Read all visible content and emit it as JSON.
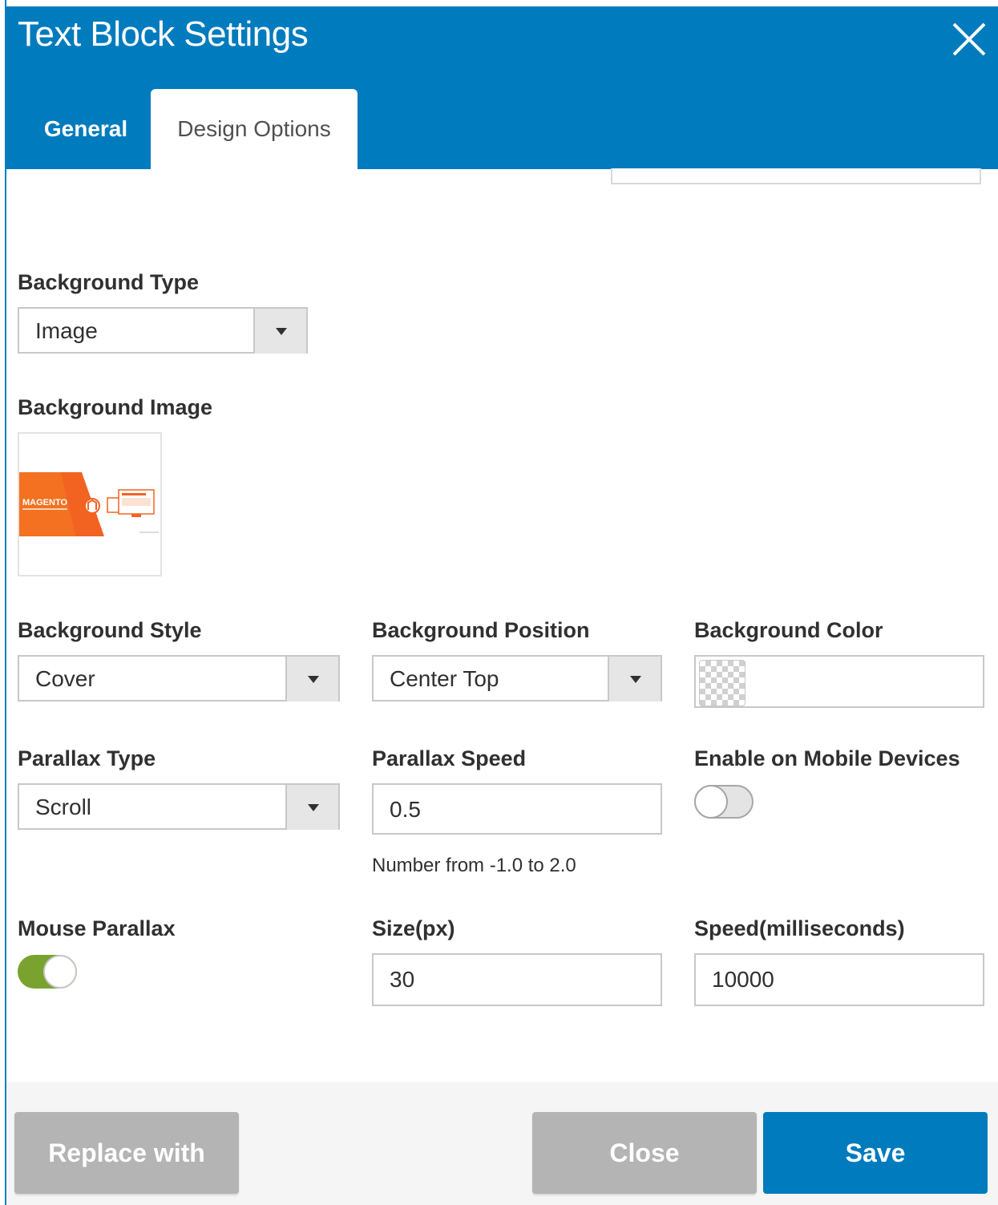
{
  "modal": {
    "title": "Text Block Settings",
    "tabs": [
      {
        "label": "General",
        "active": false
      },
      {
        "label": "Design Options",
        "active": true
      }
    ]
  },
  "form": {
    "background_type": {
      "label": "Background Type",
      "value": "Image"
    },
    "background_image": {
      "label": "Background Image",
      "thumbnail_text": "MAGENTO"
    },
    "background_style": {
      "label": "Background Style",
      "value": "Cover"
    },
    "background_position": {
      "label": "Background Position",
      "value": "Center Top"
    },
    "background_color": {
      "label": "Background Color",
      "value": ""
    },
    "parallax_type": {
      "label": "Parallax Type",
      "value": "Scroll"
    },
    "parallax_speed": {
      "label": "Parallax Speed",
      "value": "0.5",
      "hint": "Number from -1.0 to 2.0"
    },
    "enable_mobile": {
      "label": "Enable on Mobile Devices",
      "enabled": false
    },
    "mouse_parallax": {
      "label": "Mouse Parallax",
      "enabled": true
    },
    "size_px": {
      "label": "Size(px)",
      "value": "30"
    },
    "speed_ms": {
      "label": "Speed(milliseconds)",
      "value": "10000"
    }
  },
  "footer": {
    "replace_label": "Replace with",
    "close_label": "Close",
    "save_label": "Save"
  },
  "colors": {
    "header": "#007bbd",
    "primary_button": "#007bbd",
    "secondary_button": "#b4b4b4",
    "toggle_on": "#79a22e"
  },
  "icons": {
    "close": "close-icon",
    "select_arrow": "caret-down-icon"
  }
}
